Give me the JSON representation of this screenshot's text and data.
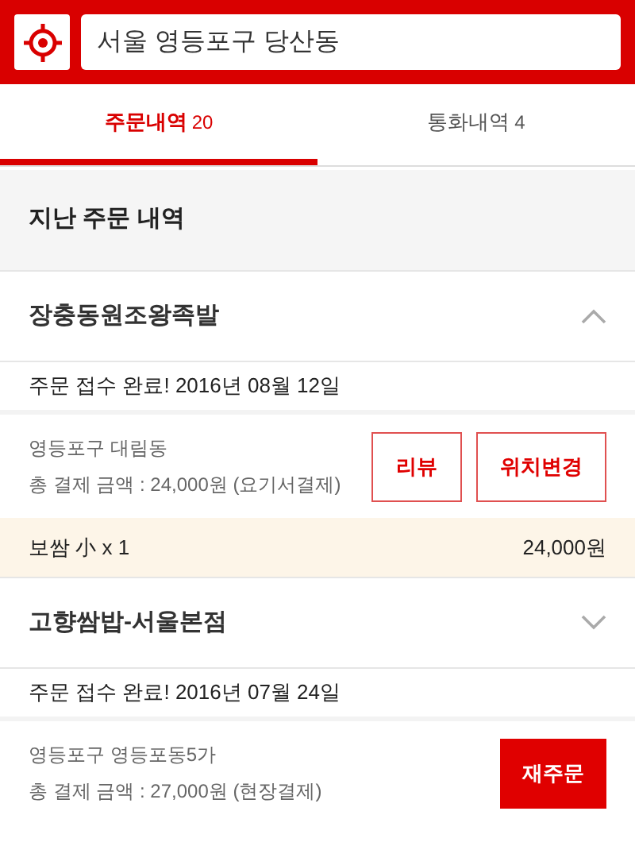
{
  "search": {
    "value": "서울 영등포구 당산동"
  },
  "tabs": [
    {
      "label": "주문내역",
      "count": "20",
      "selected": true
    },
    {
      "label": "통화내역",
      "count": "4",
      "selected": false
    }
  ],
  "section_title": "지난 주문 내역",
  "orders": [
    {
      "store": "장충동원조왕족발",
      "expanded": true,
      "status": "주문 접수 완료! 2016년 08월 12일",
      "address": "영등포구 대림동",
      "payment": "총 결제 금액 : 24,000원 (요기서결제)",
      "buttons": [
        {
          "label": "리뷰",
          "kind": "outline"
        },
        {
          "label": "위치변경",
          "kind": "outline"
        }
      ],
      "items": [
        {
          "name": "보쌈 小 x 1",
          "price": "24,000원"
        }
      ]
    },
    {
      "store": "고향쌈밥-서울본점",
      "expanded": false,
      "status": "주문 접수 완료! 2016년 07월 24일",
      "address": "영등포구 영등포동5가",
      "payment": "총 결제 금액 : 27,000원 (현장결제)",
      "buttons": [
        {
          "label": "재주문",
          "kind": "filled"
        }
      ]
    }
  ]
}
